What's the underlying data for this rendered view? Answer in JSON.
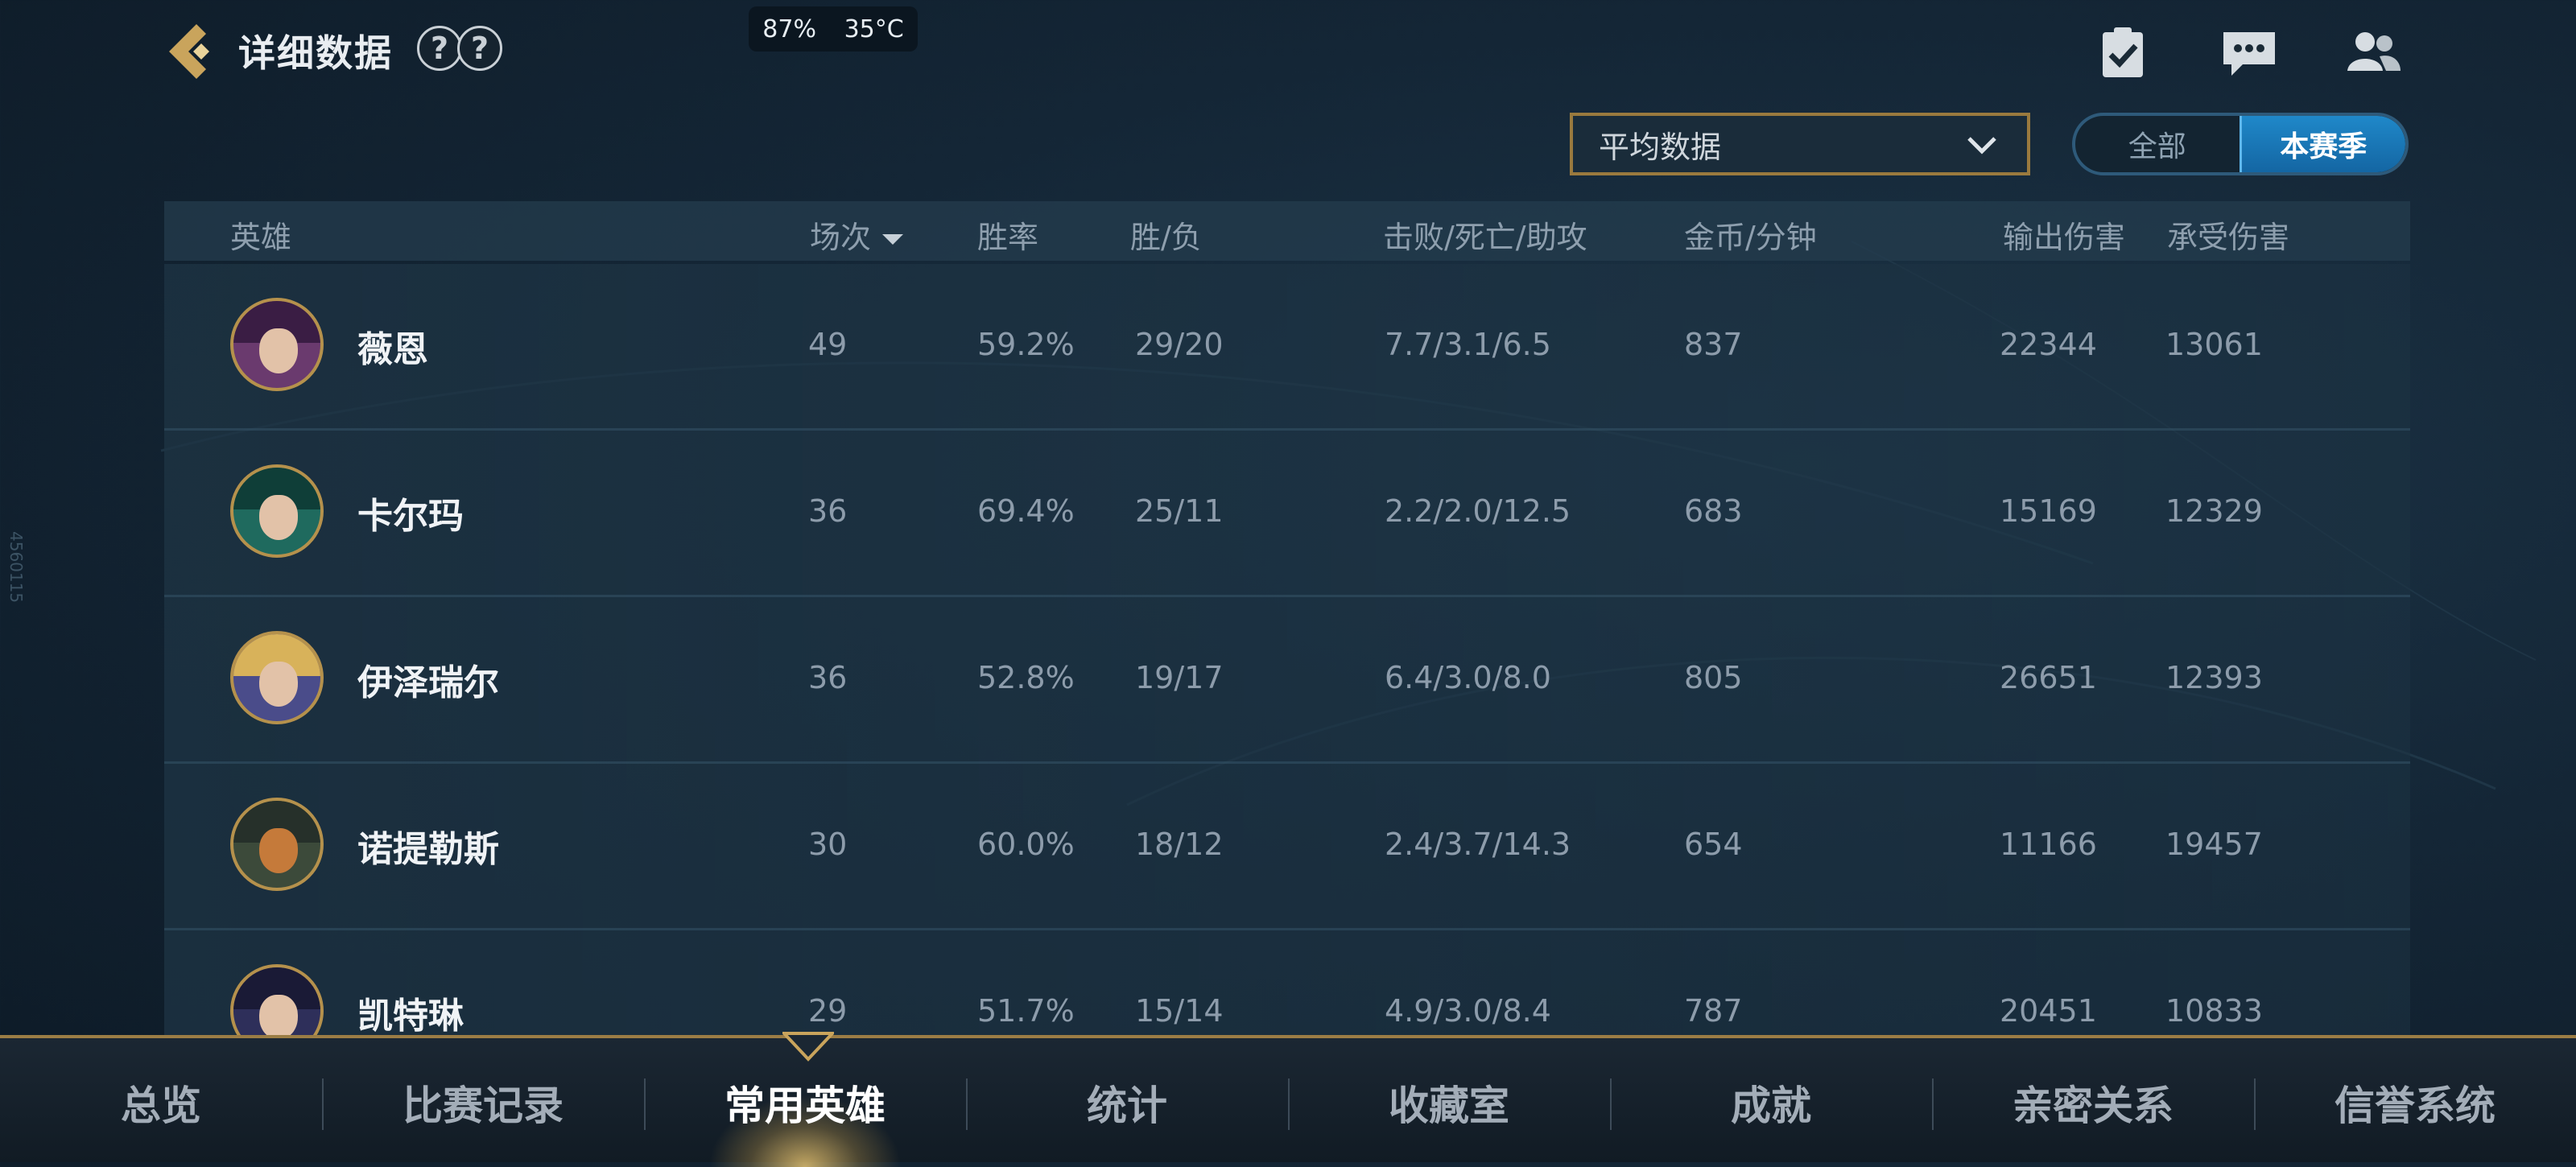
{
  "status": {
    "battery": "87%",
    "temperature": "35°C"
  },
  "watermark": "4560115",
  "header": {
    "title": "详细数据",
    "help_marks": [
      "?",
      "?"
    ]
  },
  "top_icons": [
    "task-check-icon",
    "chat-icon",
    "friends-icon"
  ],
  "filters": {
    "dropdown_value": "平均数据",
    "season_toggle": {
      "options": [
        "全部",
        "本赛季"
      ],
      "selected": "本赛季"
    }
  },
  "table": {
    "columns": [
      "英雄",
      "场次",
      "胜率",
      "胜/负",
      "击败/死亡/助攻",
      "金币/分钟",
      "输出伤害",
      "承受伤害"
    ],
    "sorted_by": "场次",
    "rows": [
      {
        "name": "薇恩",
        "games": "49",
        "winrate": "59.2%",
        "wl": "29/20",
        "kda": "7.7/3.1/6.5",
        "gpm": "837",
        "dmg_dealt": "22344",
        "dmg_taken": "13061"
      },
      {
        "name": "卡尔玛",
        "games": "36",
        "winrate": "69.4%",
        "wl": "25/11",
        "kda": "2.2/2.0/12.5",
        "gpm": "683",
        "dmg_dealt": "15169",
        "dmg_taken": "12329"
      },
      {
        "name": "伊泽瑞尔",
        "games": "36",
        "winrate": "52.8%",
        "wl": "19/17",
        "kda": "6.4/3.0/8.0",
        "gpm": "805",
        "dmg_dealt": "26651",
        "dmg_taken": "12393"
      },
      {
        "name": "诺提勒斯",
        "games": "30",
        "winrate": "60.0%",
        "wl": "18/12",
        "kda": "2.4/3.7/14.3",
        "gpm": "654",
        "dmg_dealt": "11166",
        "dmg_taken": "19457"
      },
      {
        "name": "凯特琳",
        "games": "29",
        "winrate": "51.7%",
        "wl": "15/14",
        "kda": "4.9/3.0/8.4",
        "gpm": "787",
        "dmg_dealt": "20451",
        "dmg_taken": "10833"
      }
    ]
  },
  "bottom_nav": {
    "items": [
      "总览",
      "比赛记录",
      "常用英雄",
      "统计",
      "收藏室",
      "成就",
      "亲密关系",
      "信誉系统"
    ],
    "active": "常用英雄"
  },
  "colors": {
    "accent_gold": "#9b7d45",
    "toggle_blue": "#1a7fc0"
  }
}
